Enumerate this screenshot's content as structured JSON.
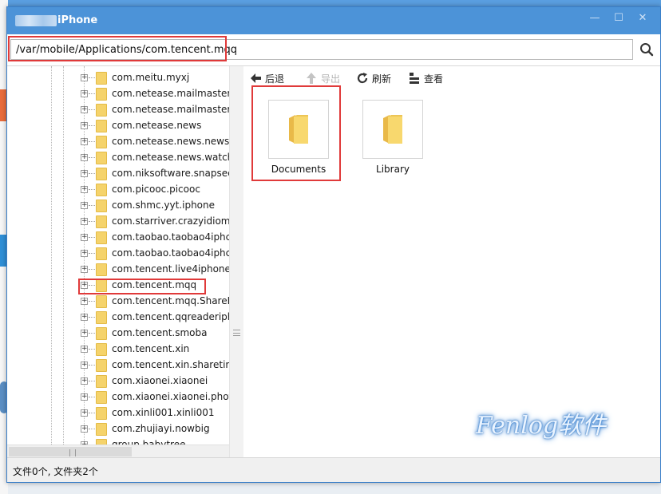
{
  "window": {
    "title": "iPhone",
    "controls": {
      "minimize": "—",
      "maximize": "☐",
      "close": "✕"
    }
  },
  "address": {
    "path": "/var/mobile/Applications/com.tencent.mqq"
  },
  "tree": {
    "items": [
      "com.meitu.myxj",
      "com.netease.mailmaster",
      "com.netease.mailmaster.s",
      "com.netease.news",
      "com.netease.news.newsb",
      "com.netease.news.watchk",
      "com.niksoftware.snapsee",
      "com.picooc.picooc",
      "com.shmc.yyt.iphone",
      "com.starriver.crazyidiom",
      "com.taobao.taobao4iphc",
      "com.taobao.taobao4iphc",
      "com.tencent.live4iphone",
      "com.tencent.mqq",
      "com.tencent.mqq.ShareEx",
      "com.tencent.qqreaderiph",
      "com.tencent.smoba",
      "com.tencent.xin",
      "com.tencent.xin.sharetime",
      "com.xiaonei.xiaonei",
      "com.xiaonei.xiaonei.photo",
      "com.xinli001.xinli001",
      "com.zhujiayi.nowbig",
      "group.babytree"
    ],
    "selected_index": 13
  },
  "toolbar": {
    "back": "后退",
    "export": "导出",
    "refresh": "刷新",
    "view": "查看"
  },
  "files": [
    {
      "name": "Documents",
      "icon": "folder-icon"
    },
    {
      "name": "Library",
      "icon": "folder-icon"
    }
  ],
  "status": {
    "text": "文件0个, 文件夹2个"
  },
  "watermark": {
    "text": "Fenlog软件"
  },
  "colors": {
    "titlebar": "#4c93d8",
    "highlight": "#e03a3a",
    "folder": "#f5d36b"
  }
}
